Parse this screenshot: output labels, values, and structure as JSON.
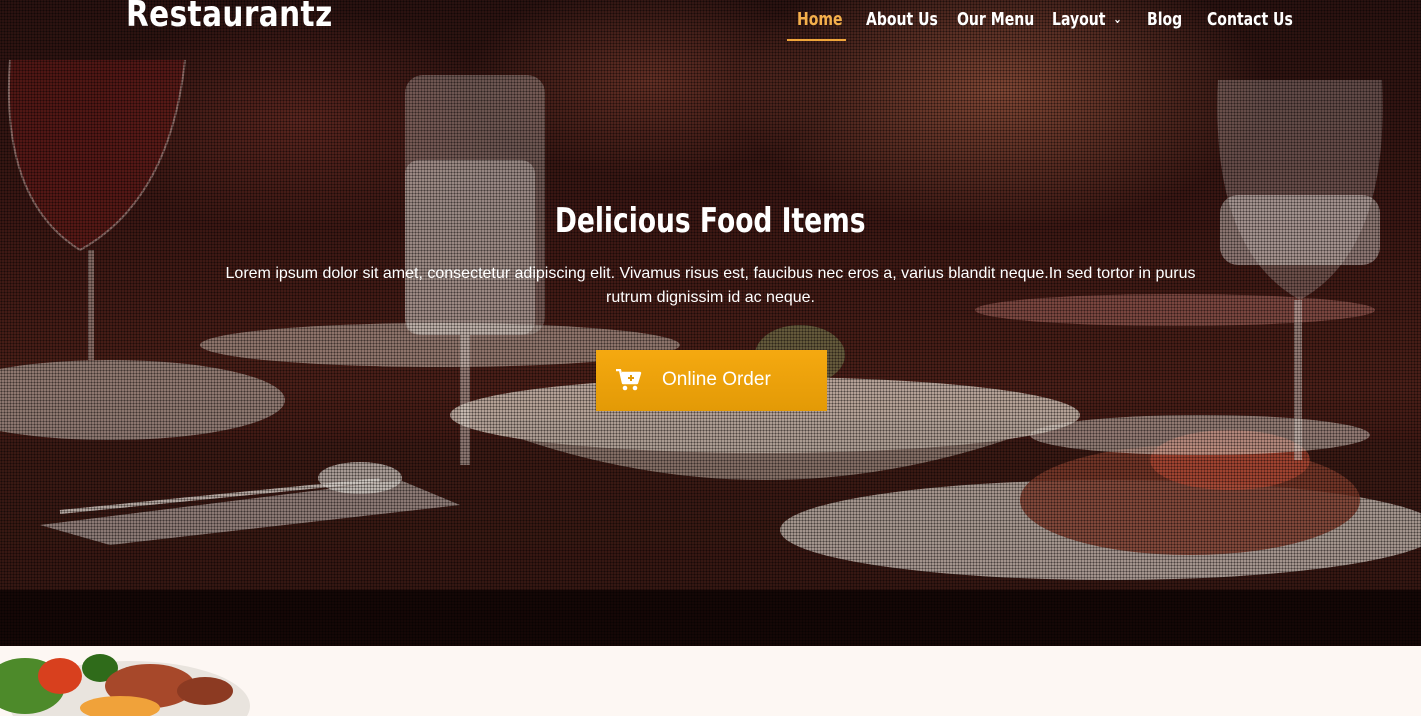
{
  "brand": {
    "name": "Restaurantz"
  },
  "nav": {
    "items": [
      {
        "label": "Home",
        "active": true
      },
      {
        "label": "About Us"
      },
      {
        "label": "Our Menu"
      },
      {
        "label": "Layout",
        "has_dropdown": true
      },
      {
        "label": "Blog"
      },
      {
        "label": "Contact Us"
      }
    ]
  },
  "hero": {
    "title": "Delicious Food Items",
    "text": "Lorem ipsum dolor sit amet, consectetur adipiscing elit. Vivamus risus est, faucibus nec eros a, varius blandit neque.In sed tortor in purus rutrum dignissim id ac neque.",
    "button": {
      "label": "Online Order",
      "icon": "cart-plus-icon"
    }
  },
  "colors": {
    "accent": "#f0a63a",
    "button": "#f5a910",
    "page_bg": "#fdf7f3"
  }
}
